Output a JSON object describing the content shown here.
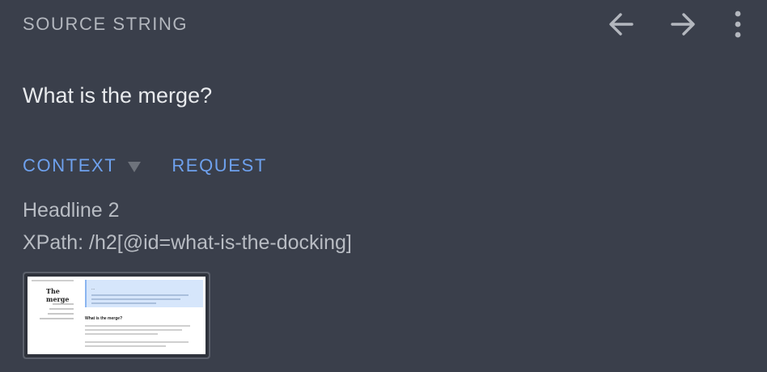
{
  "header": {
    "label": "SOURCE STRING",
    "back_icon": "arrow-left-icon",
    "forward_icon": "arrow-right-icon",
    "menu_icon": "more-vert-icon"
  },
  "source": {
    "text": "What is the merge?"
  },
  "tabs": {
    "context_label": "CONTEXT",
    "request_label": "REQUEST"
  },
  "context": {
    "element_type": "Headline 2",
    "xpath": "XPath: /h2[@id=what-is-the-docking]"
  },
  "thumbnail": {
    "page_title": "The merge",
    "banner_title": "...",
    "section_heading": "What is the merge?"
  },
  "colors": {
    "background": "#3a3f4b",
    "accent": "#6ea1ee",
    "text": "#e8eaed",
    "muted": "#b3b7be"
  }
}
